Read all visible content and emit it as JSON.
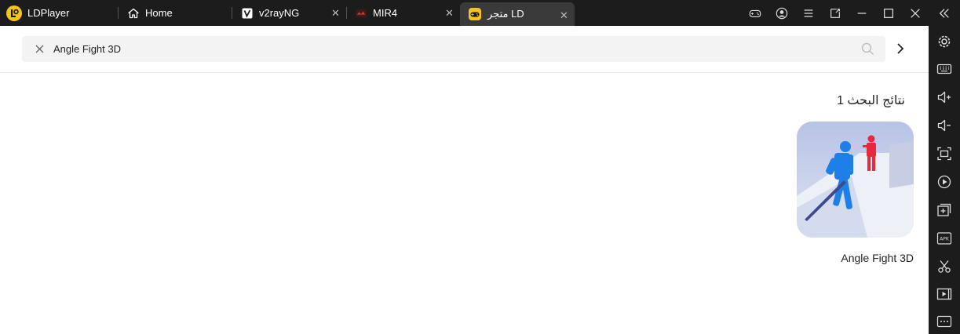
{
  "app": {
    "name": "LDPlayer"
  },
  "tabs": [
    {
      "label": "Home",
      "icon": "home-icon"
    },
    {
      "label": "v2rayNG",
      "icon": "v2rayng-icon"
    },
    {
      "label": "MIR4",
      "icon": "mir4-icon"
    },
    {
      "label": "متجر LD",
      "icon": "gamepad-icon",
      "active": true
    }
  ],
  "search": {
    "value": "Angle Fight 3D"
  },
  "results": {
    "heading": "نتائج البحث 1",
    "apps": [
      {
        "name": "Angle Fight 3D"
      }
    ]
  },
  "colors": {
    "titlebar": "#1c1c1c",
    "active_tab": "#3a3a3a",
    "brand_accent": "#f6c21d",
    "search_bg": "#f3f3f3"
  }
}
